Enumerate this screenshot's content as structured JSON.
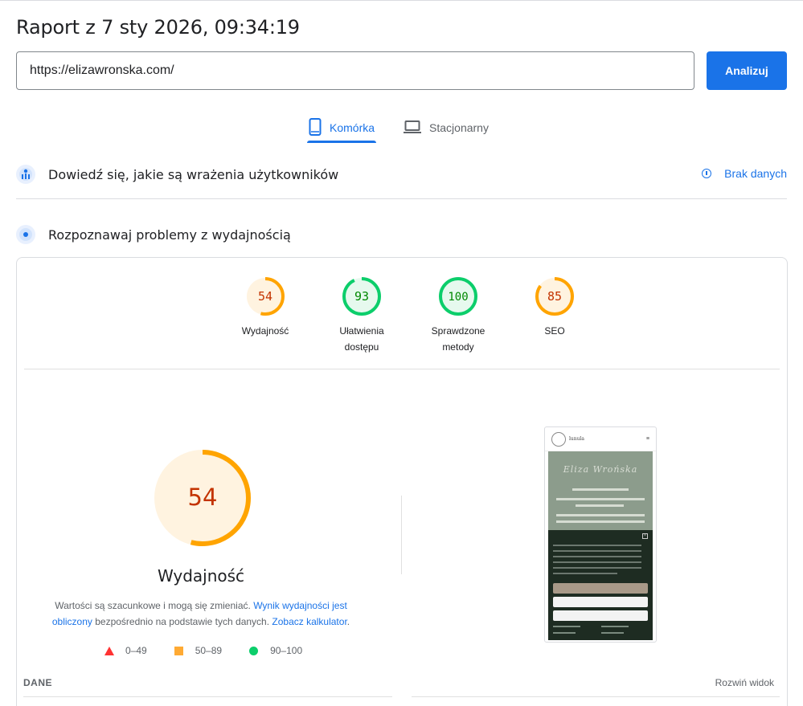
{
  "header": {
    "title": "Raport z 7 sty 2026, 09:34:19",
    "url_value": "https://elizawronska.com/",
    "analyze_label": "Analizuj"
  },
  "tabs": [
    {
      "label": "Komórka",
      "icon": "smartphone-icon",
      "active": true
    },
    {
      "label": "Stacjonarny",
      "icon": "laptop-icon",
      "active": false
    }
  ],
  "field_data": {
    "title": "Dowiedź się, jakie są wrażenia użytkowników",
    "no_data_label": "Brak danych"
  },
  "lab_data": {
    "title": "Rozpoznawaj problemy z wydajnością"
  },
  "scores": [
    {
      "value": 54,
      "label": "Wydajność",
      "status": "average"
    },
    {
      "value": 93,
      "label": "Ułatwienia dostępu",
      "status": "pass"
    },
    {
      "value": 100,
      "label": "Sprawdzone metody",
      "status": "pass"
    },
    {
      "value": 85,
      "label": "SEO",
      "status": "average"
    }
  ],
  "performance": {
    "score": "54",
    "title": "Wydajność",
    "desc_part1": "Wartości są szacunkowe i mogą się zmieniać.",
    "desc_link1": "Wynik wydajności jest obliczony",
    "desc_part2": "bezpośrednio na podstawie tych danych.",
    "desc_link2": "Zobacz kalkulator",
    "desc_end": "."
  },
  "legend": [
    {
      "range": "0–49",
      "shape": "triangle",
      "color": "#ff3333"
    },
    {
      "range": "50–89",
      "shape": "square",
      "color": "#ffaa33"
    },
    {
      "range": "90–100",
      "shape": "circle",
      "color": "#0cce6b"
    }
  ],
  "metrics": {
    "header": "DANE",
    "expand_label": "Rozwiń widok"
  },
  "thumbnail": {
    "brand": "lunula",
    "hero_script": "Eliza Wrońska"
  },
  "colors": {
    "accent": "#1a73e8",
    "pass": "#0cce6b",
    "average": "#ffa400",
    "fail": "#ff3333"
  }
}
